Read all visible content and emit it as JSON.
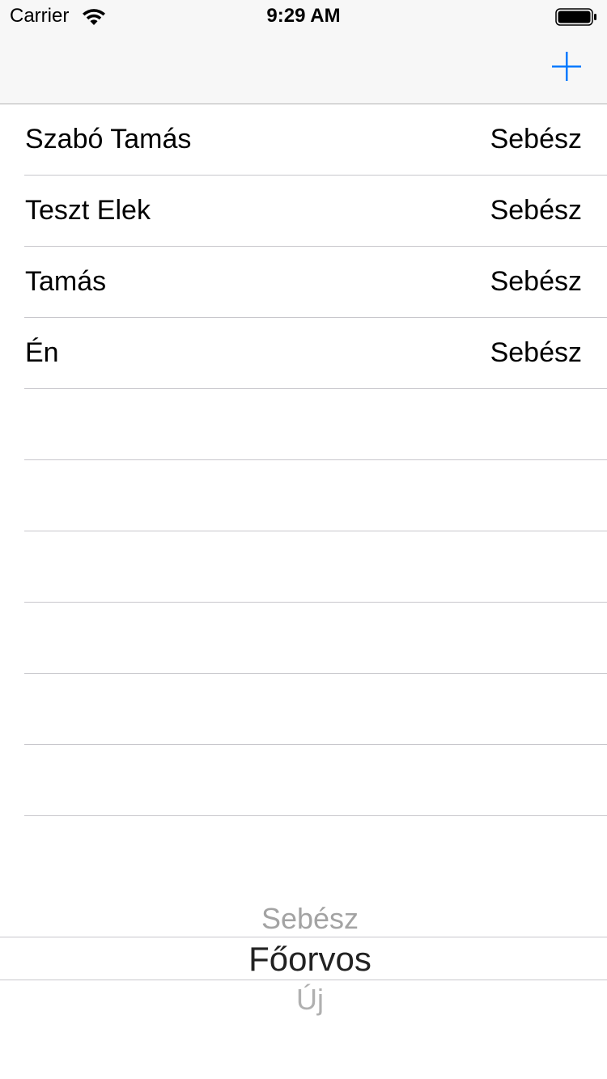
{
  "status_bar": {
    "carrier": "Carrier",
    "time": "9:29 AM"
  },
  "nav_bar": {
    "add_button_icon": "plus-icon",
    "accent_color": "#007aff"
  },
  "table": {
    "rows": [
      {
        "title": "Szabó Tamás",
        "detail": "Sebész"
      },
      {
        "title": "Teszt Elek",
        "detail": "Sebész"
      },
      {
        "title": "Tamás",
        "detail": "Sebész"
      },
      {
        "title": "Én",
        "detail": "Sebész"
      },
      {
        "title": "",
        "detail": ""
      },
      {
        "title": "",
        "detail": ""
      },
      {
        "title": "",
        "detail": ""
      },
      {
        "title": "",
        "detail": ""
      },
      {
        "title": "",
        "detail": ""
      },
      {
        "title": "",
        "detail": ""
      }
    ]
  },
  "picker": {
    "options": [
      "Sebész",
      "Főorvos",
      "Új"
    ],
    "selected": "Főorvos"
  }
}
